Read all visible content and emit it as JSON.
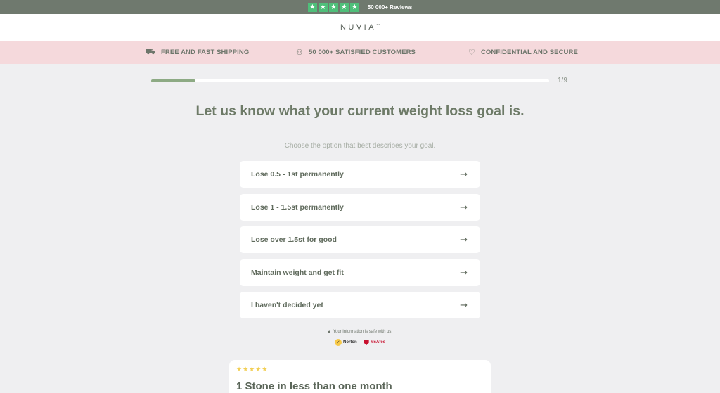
{
  "topbar": {
    "star_icon": "star-icon",
    "star_count": 5,
    "reviews_text": "50 000+ Reviews",
    "star_color": "#4fbf7a"
  },
  "header": {
    "logo": "NUVIA",
    "logo_mark": "™"
  },
  "benefits": [
    {
      "icon": "truck-icon",
      "label": "FREE AND FAST SHIPPING"
    },
    {
      "icon": "people-icon",
      "label": "50 000+ SATISFIED CUSTOMERS"
    },
    {
      "icon": "heart-icon",
      "label": "CONFIDENTIAL AND SECURE"
    }
  ],
  "progress": {
    "current": 1,
    "total": 9,
    "label": "1/9"
  },
  "question": {
    "title": "Let us know what your current weight loss goal is.",
    "subtitle": "Choose the option that best describes your goal."
  },
  "options": [
    {
      "label": "Lose 0.5 - 1st permanently"
    },
    {
      "label": "Lose 1 - 1.5st permanently"
    },
    {
      "label": "Lose over 1.5st for good"
    },
    {
      "label": "Maintain weight and get fit"
    },
    {
      "label": "I haven't decided yet"
    }
  ],
  "security": {
    "text": "Your information is safe with us.",
    "badges": [
      "Norton",
      "McAfee"
    ]
  },
  "review": {
    "stars": "★★★★★",
    "title": "1 Stone in less than one month"
  },
  "colors": {
    "accent": "#6f796e",
    "benefit_bg": "#f5d9dc",
    "progress_fill": "#8daa84",
    "page_bg": "#efeff1"
  }
}
